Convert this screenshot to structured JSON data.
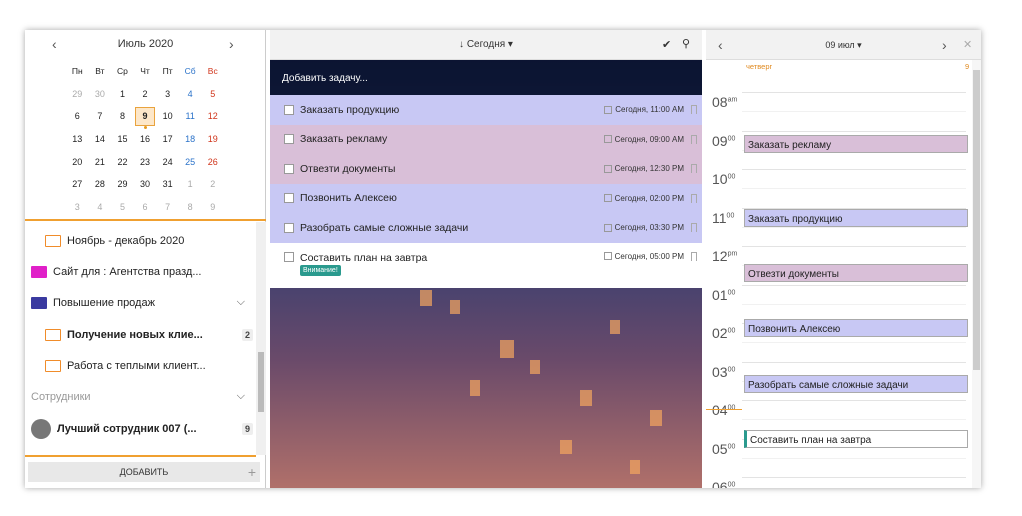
{
  "calendar": {
    "month_title": "Июль 2020",
    "prev_icon": "‹",
    "next_icon": "›",
    "weekdays": [
      "Пн",
      "Вт",
      "Ср",
      "Чт",
      "Пт",
      "Сб",
      "Вс"
    ],
    "weeks": [
      [
        "29",
        "30",
        "1",
        "2",
        "3",
        "4",
        "5"
      ],
      [
        "6",
        "7",
        "8",
        "9",
        "10",
        "11",
        "12"
      ],
      [
        "13",
        "14",
        "15",
        "16",
        "17",
        "18",
        "19"
      ],
      [
        "20",
        "21",
        "22",
        "23",
        "24",
        "25",
        "26"
      ],
      [
        "27",
        "28",
        "29",
        "30",
        "31",
        "1",
        "2"
      ],
      [
        "3",
        "4",
        "5",
        "6",
        "7",
        "8",
        "9"
      ]
    ],
    "selected_day": "9"
  },
  "folders": {
    "items": [
      {
        "label": "Ноябрь - декабрь 2020",
        "color": "#f08c2a"
      },
      {
        "label": "Сайт для : Агентства празд...",
        "color": "#e020c8"
      },
      {
        "label": "Повышение продаж",
        "color": "#3a3aa0"
      },
      {
        "label": "Получение новых клие...",
        "color": "#f08c2a",
        "count": "2"
      },
      {
        "label": "Работа с теплыми клиент...",
        "color": "#f08c2a"
      }
    ],
    "section_label": "Сотрудники",
    "employee": {
      "label": "Лучший сотрудник 007 (...",
      "count": "9"
    }
  },
  "add_button": {
    "label": "ДОБАВИТЬ",
    "plus": "+"
  },
  "tasks_header": {
    "title": "↓ Сегодня ▾"
  },
  "add_task_placeholder": "Добавить задачу...",
  "tasks": [
    {
      "text": "Заказать продукцию",
      "date": "Сегодня, 11:00 AM",
      "color": "#c8c8f4"
    },
    {
      "text": "Заказать рекламу",
      "date": "Сегодня, 09:00 AM",
      "color": "#d9bfd8"
    },
    {
      "text": "Отвезти документы",
      "date": "Сегодня, 12:30 PM",
      "color": "#d9bfd8"
    },
    {
      "text": "Позвонить Алексею",
      "date": "Сегодня, 02:00 PM",
      "color": "#c8c8f4"
    },
    {
      "text": "Разобрать самые сложные задачи",
      "date": "Сегодня, 03:30 PM",
      "color": "#c8c8f4"
    },
    {
      "text": "Составить план на завтра",
      "date": "Сегодня, 05:00 PM",
      "color": "#ffffff",
      "badge": "Внимание!"
    }
  ],
  "day_view": {
    "title": "09 июл ▾",
    "weekday": "четверг",
    "count": "9",
    "hours": [
      {
        "h": "08",
        "s": "am"
      },
      {
        "h": "09",
        "s": "00"
      },
      {
        "h": "10",
        "s": "00"
      },
      {
        "h": "11",
        "s": "00"
      },
      {
        "h": "12",
        "s": "pm"
      },
      {
        "h": "01",
        "s": "00"
      },
      {
        "h": "02",
        "s": "00"
      },
      {
        "h": "03",
        "s": "00"
      },
      {
        "h": "04",
        "s": "00"
      },
      {
        "h": "05",
        "s": "00"
      },
      {
        "h": "06",
        "s": "00"
      }
    ],
    "events": [
      {
        "text": "Заказать рекламу",
        "color": "#d9bfd8"
      },
      {
        "text": "Заказать продукцию",
        "color": "#c8c8f4"
      },
      {
        "text": "Отвезти документы",
        "color": "#d9bfd8"
      },
      {
        "text": "Позвонить Алексею",
        "color": "#c8c8f4"
      },
      {
        "text": "Разобрать самые сложные задачи",
        "color": "#c8c8f4"
      },
      {
        "text": "Составить план на завтра",
        "color": "#ffffff"
      }
    ]
  }
}
